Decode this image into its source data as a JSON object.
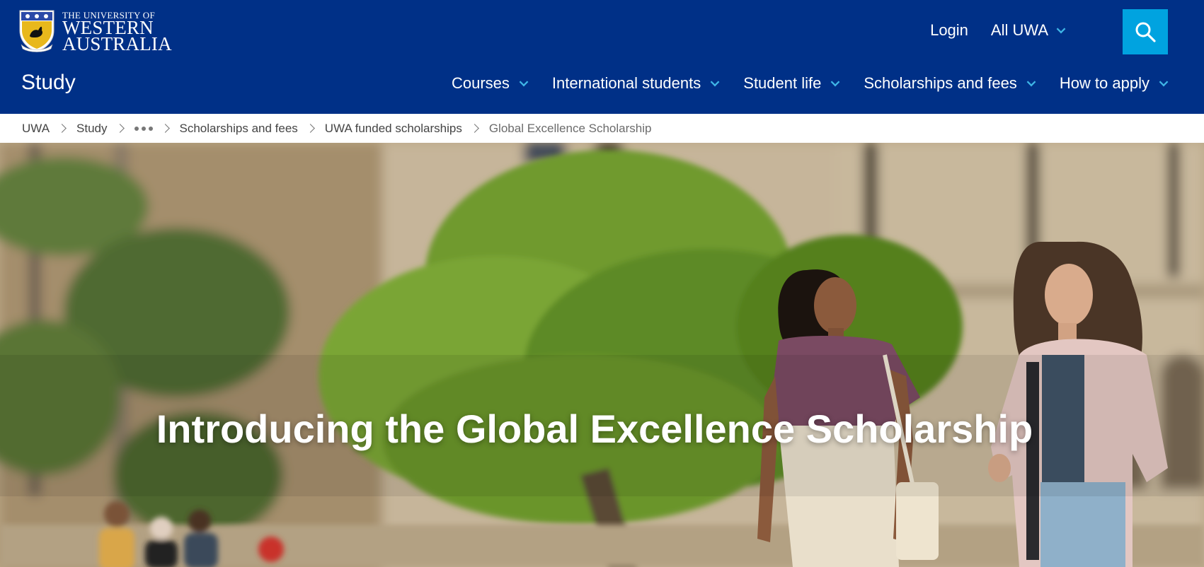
{
  "header": {
    "logo": {
      "line1": "THE UNIVERSITY OF",
      "line2": "WESTERN",
      "line3": "AUSTRALIA"
    },
    "top_links": {
      "login": "Login",
      "all_uwa": "All UWA"
    },
    "search_icon": "search-icon",
    "section_title": "Study",
    "nav": [
      {
        "label": "Courses"
      },
      {
        "label": "International students"
      },
      {
        "label": "Student life"
      },
      {
        "label": "Scholarships and fees"
      },
      {
        "label": "How to apply"
      }
    ],
    "colors": {
      "brand_blue": "#003087",
      "accent_cyan": "#00a3e0",
      "chevron": "#3fb6e6"
    }
  },
  "breadcrumb": {
    "items": [
      "UWA",
      "Study",
      "Scholarships and fees",
      "UWA funded scholarships"
    ],
    "current": "Global Excellence Scholarship",
    "collapsed_icon": "ellipsis-icon"
  },
  "hero": {
    "title": "Introducing the Global Excellence Scholarship"
  }
}
